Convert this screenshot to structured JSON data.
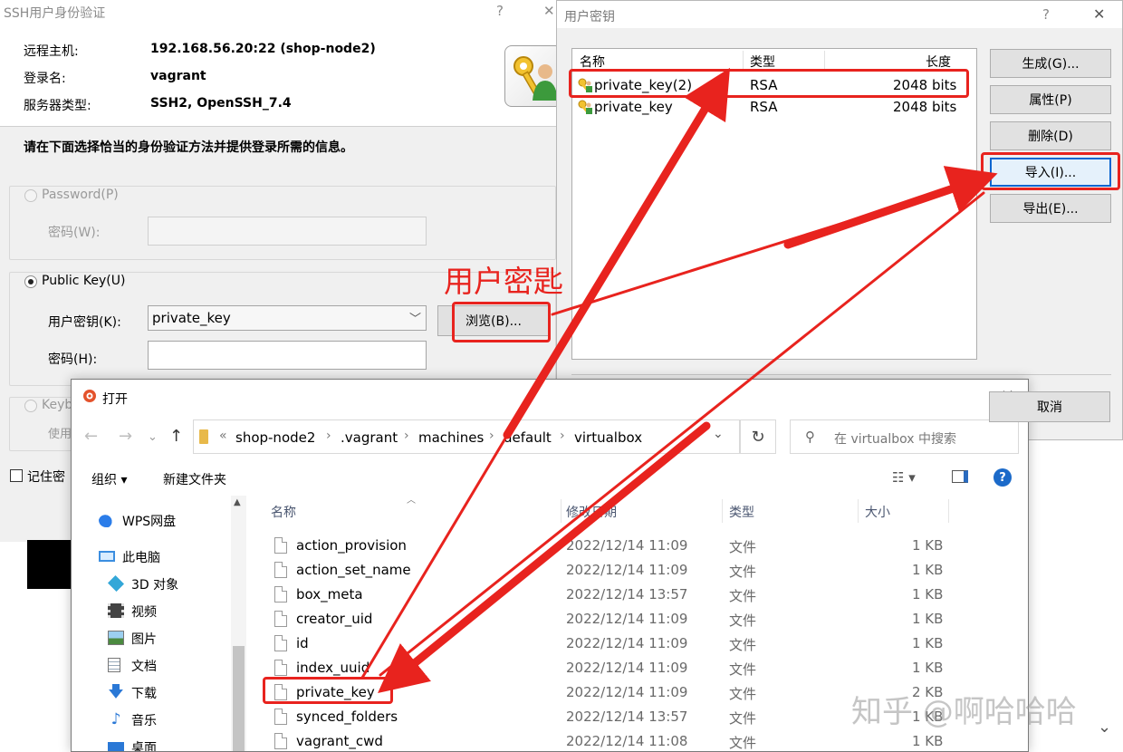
{
  "ssh_dialog": {
    "title": "SSH用户身份验证",
    "help_icon": "?",
    "close_icon": "✕",
    "remote_host_label": "远程主机:",
    "remote_host_value": "192.168.56.20:22 (shop-node2)",
    "login_name_label": "登录名:",
    "login_name_value": "vagrant",
    "server_type_label": "服务器类型:",
    "server_type_value": "SSH2, OpenSSH_7.4",
    "instruction": "请在下面选择恰当的身份验证方法并提供登录所需的信息。",
    "password_option": "Password(P)",
    "password_field_label": "密码(W):",
    "publickey_option": "Public Key(U)",
    "user_key_label": "用户密钥(K):",
    "user_key_value": "private_key",
    "passphrase_label": "密码(H):",
    "browse_button": "浏览(B)...",
    "keyboard_option": "Keyb",
    "keyboard_use_label": "使用",
    "remember_checkbox": "记住密"
  },
  "keys_dialog": {
    "title": "用户密钥",
    "help_icon": "?",
    "close_icon": "✕",
    "columns": {
      "name": "名称",
      "type": "类型",
      "length": "长度"
    },
    "rows": [
      {
        "name": "private_key(2)",
        "type": "RSA",
        "length": "2048 bits"
      },
      {
        "name": "private_key",
        "type": "RSA",
        "length": "2048 bits"
      }
    ],
    "buttons": {
      "generate": "生成(G)...",
      "properties": "属性(P)",
      "delete": "删除(D)",
      "import": "导入(I)...",
      "export": "导出(E)...",
      "cancel": "取消"
    }
  },
  "open_dialog": {
    "title": "打开",
    "close_icon": "✕",
    "breadcrumb_prefix": "«",
    "breadcrumb": [
      "shop-node2",
      ".vagrant",
      "machines",
      "default",
      "virtualbox"
    ],
    "breadcrumb_sep": "›",
    "search_placeholder": "在 virtualbox 中搜索",
    "toolbar": {
      "organize": "组织 ▾",
      "new_folder": "新建文件夹"
    },
    "nav_items": [
      "WPS网盘",
      "此电脑",
      "3D 对象",
      "视频",
      "图片",
      "文档",
      "下载",
      "音乐",
      "桌面"
    ],
    "columns": {
      "name": "名称",
      "modified": "修改日期",
      "type": "类型",
      "size": "大小"
    },
    "files": [
      {
        "name": "action_provision",
        "modified": "2022/12/14 11:09",
        "type": "文件",
        "size": "1 KB"
      },
      {
        "name": "action_set_name",
        "modified": "2022/12/14 11:09",
        "type": "文件",
        "size": "1 KB"
      },
      {
        "name": "box_meta",
        "modified": "2022/12/14 13:57",
        "type": "文件",
        "size": "1 KB"
      },
      {
        "name": "creator_uid",
        "modified": "2022/12/14 11:09",
        "type": "文件",
        "size": "1 KB"
      },
      {
        "name": "id",
        "modified": "2022/12/14 11:09",
        "type": "文件",
        "size": "1 KB"
      },
      {
        "name": "index_uuid",
        "modified": "2022/12/14 11:09",
        "type": "文件",
        "size": "1 KB"
      },
      {
        "name": "private_key",
        "modified": "2022/12/14 11:09",
        "type": "文件",
        "size": "2 KB"
      },
      {
        "name": "synced_folders",
        "modified": "2022/12/14 13:57",
        "type": "文件",
        "size": "1 KB"
      },
      {
        "name": "vagrant_cwd",
        "modified": "2022/12/14 11:08",
        "type": "文件",
        "size": "1 KB"
      }
    ]
  },
  "annotation": {
    "label": "用户密匙",
    "color": "#e8231e"
  },
  "watermark": "知乎 @啊哈哈哈"
}
